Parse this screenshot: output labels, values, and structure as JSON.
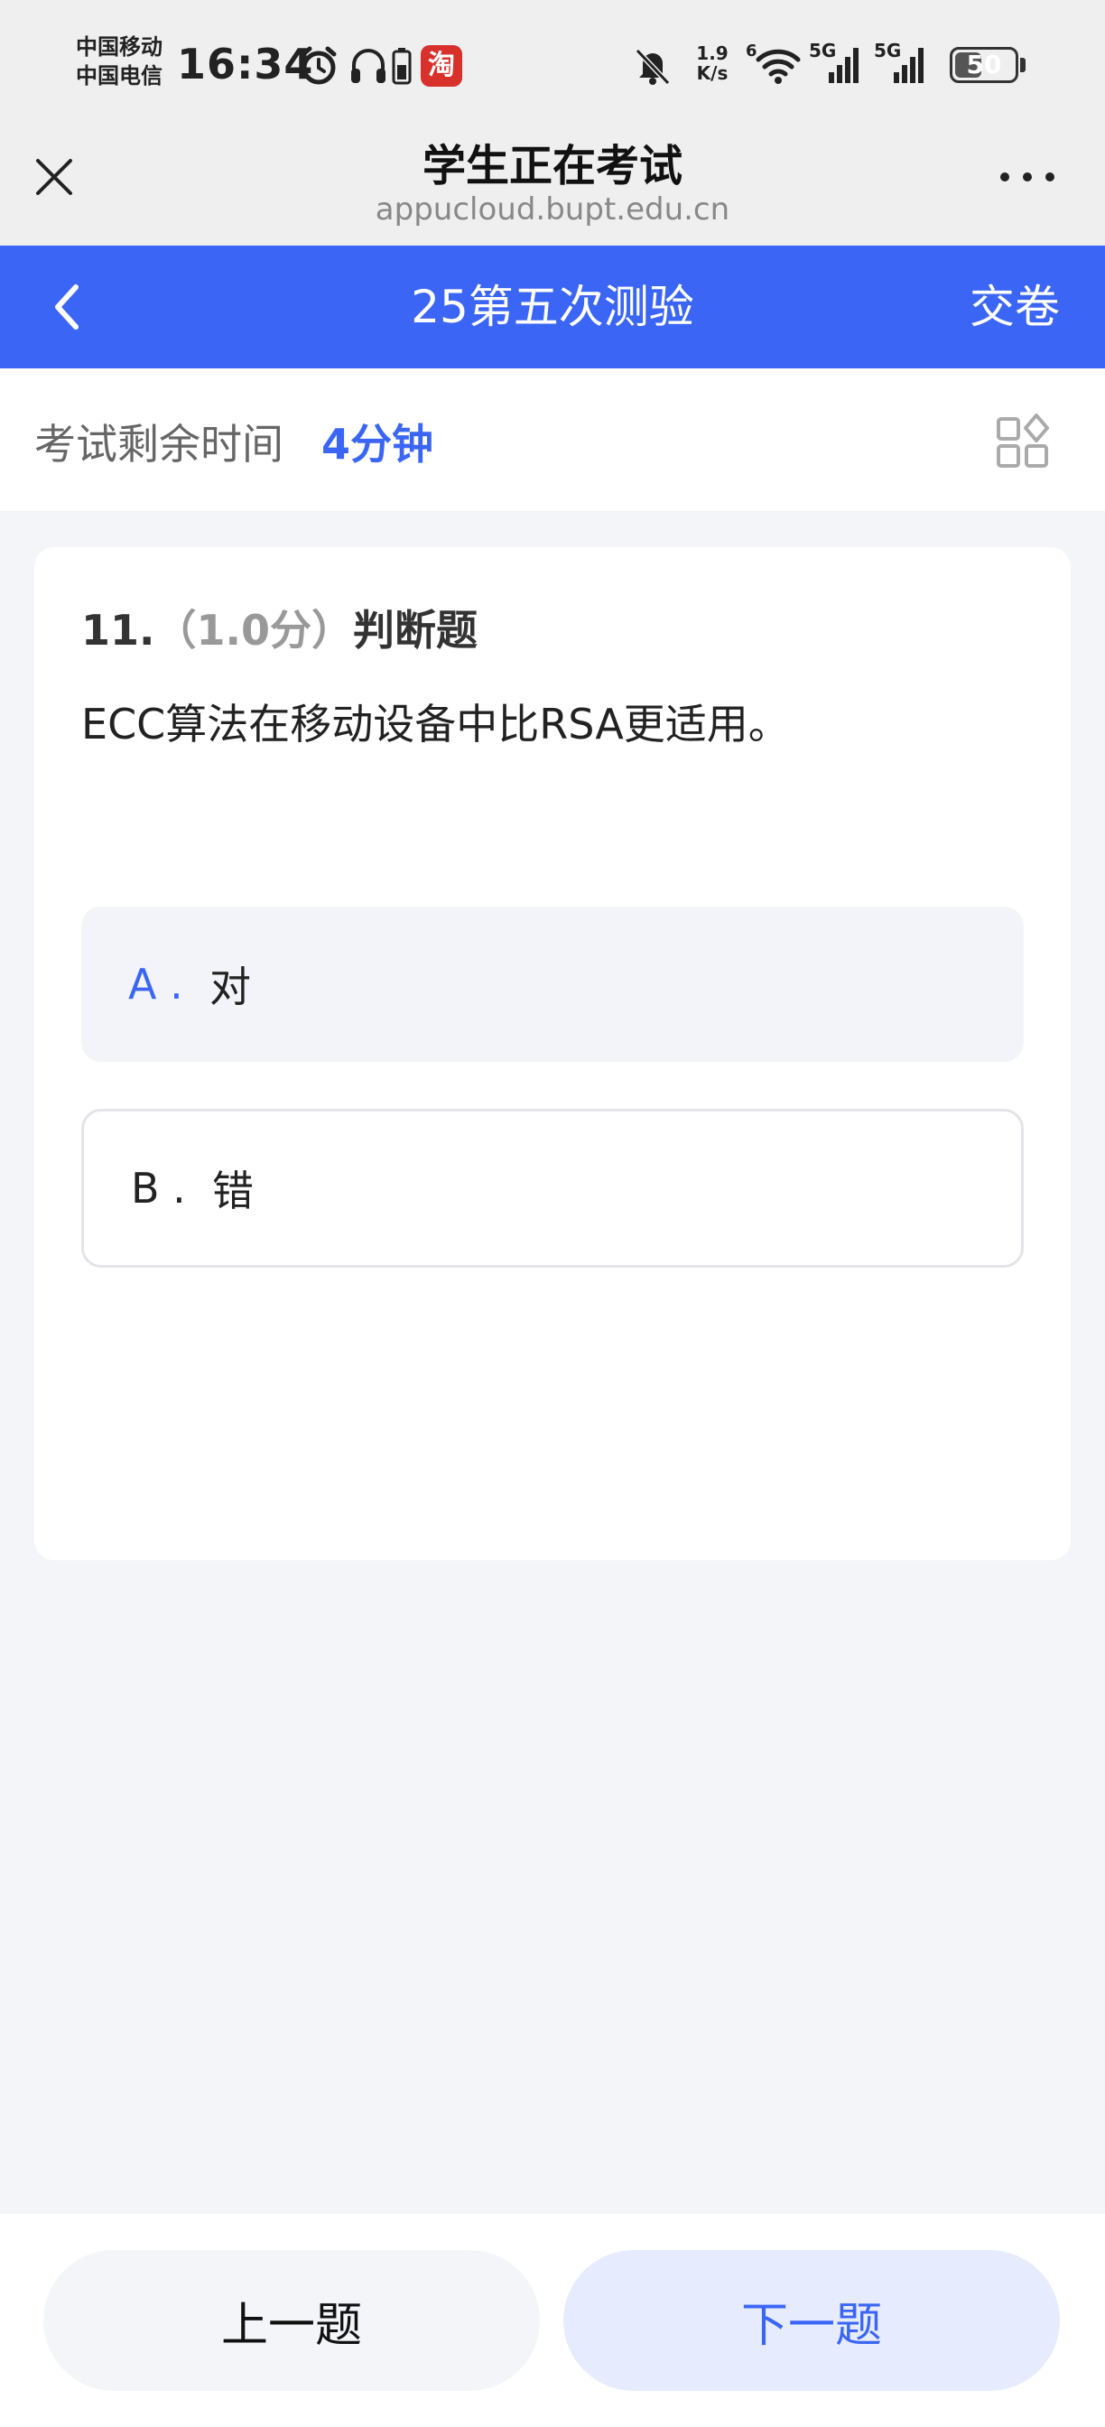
{
  "status_bar": {
    "carrier_1": "中国移动",
    "carrier_2": "中国电信",
    "time": "16:34",
    "app_badge": "淘",
    "net_speed_value": "1.9",
    "net_speed_unit": "K/s",
    "wifi_label": "6",
    "signal_1_label": "5G",
    "signal_2_label": "5G",
    "battery": "50",
    "icons": [
      "alarm-icon",
      "headphones-icon",
      "battery-small-icon",
      "taobao-icon",
      "mute-bell-icon",
      "wifi-icon",
      "signal-icon",
      "signal-icon"
    ]
  },
  "browser": {
    "title": "学生正在考试",
    "url": "appucloud.bupt.edu.cn"
  },
  "header": {
    "title": "25第五次测验",
    "submit_label": "交卷"
  },
  "timer": {
    "label": "考试剩余时间",
    "value": "4分钟"
  },
  "question": {
    "number": "11.",
    "score": "（1.0分）",
    "type": "判断题",
    "text": "ECC算法在移动设备中比RSA更适用。",
    "options": [
      {
        "letter": "A .",
        "text": "对"
      },
      {
        "letter": "B .",
        "text": "错"
      }
    ]
  },
  "footer": {
    "prev_label": "上一题",
    "next_label": "下一题"
  },
  "colors": {
    "accent": "#3b66f5",
    "background": "#f4f5f9",
    "next_button_bg": "#e6ecfd"
  }
}
